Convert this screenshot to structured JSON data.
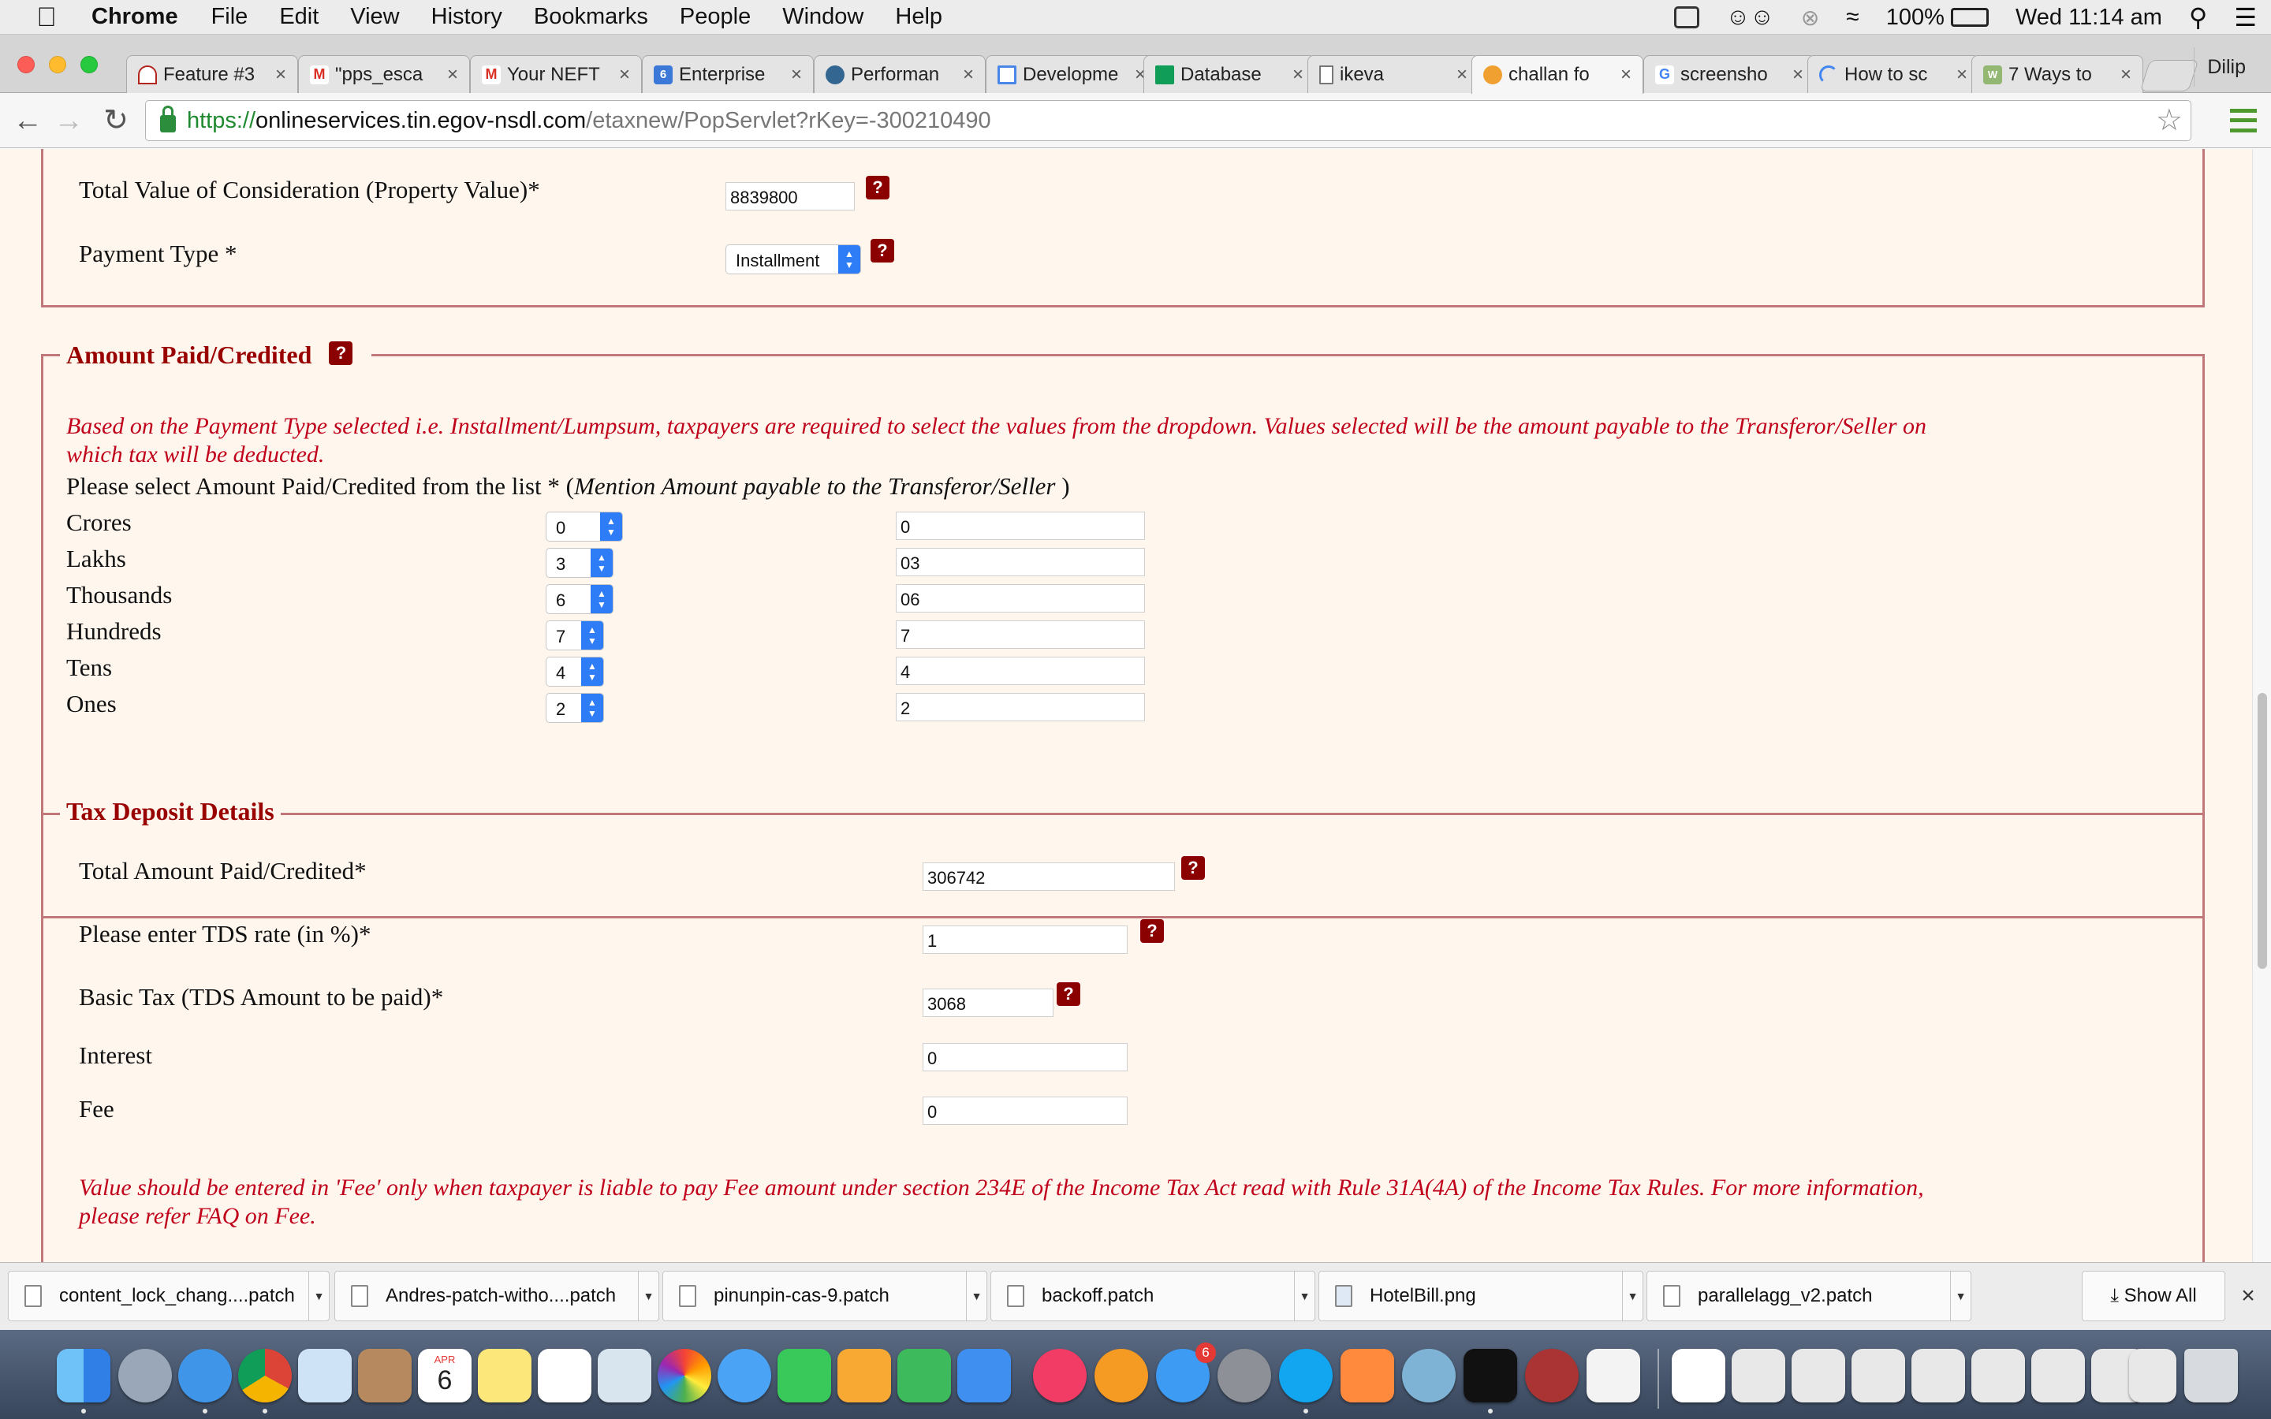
{
  "menubar": {
    "app": "Chrome",
    "menus": [
      "File",
      "Edit",
      "View",
      "History",
      "Bookmarks",
      "People",
      "Window",
      "Help"
    ],
    "battery": "100%",
    "clock": "Wed 11:14 am"
  },
  "tabs": [
    {
      "title": "Feature #3",
      "icon": "redmine-icon"
    },
    {
      "title": "\"pps_esca",
      "icon": "gmail-icon"
    },
    {
      "title": "Your NEFT",
      "icon": "gmail-icon"
    },
    {
      "title": "Enterprise",
      "icon": "calendar-icon"
    },
    {
      "title": "Performan",
      "icon": "postgres-icon"
    },
    {
      "title": "Developme",
      "icon": "doc-icon"
    },
    {
      "title": "Database",
      "icon": "sheets-icon"
    },
    {
      "title": "ikeva",
      "icon": "page-icon"
    },
    {
      "title": "challan fo",
      "icon": "site-icon"
    },
    {
      "title": "screensho",
      "icon": "google-icon"
    },
    {
      "title": "How to sc",
      "icon": "loading-icon"
    },
    {
      "title": "7 Ways to",
      "icon": "wikihow-icon"
    }
  ],
  "profile_name": "Dilip",
  "address_bar": {
    "scheme": "https://",
    "host": "onlineservices.tin.egov-nsdl.com",
    "path": "/etaxnew/PopServlet?rKey=-300210490"
  },
  "property": {
    "consideration_label": "Total Value of Consideration (Property Value)*",
    "consideration_value": "8839800",
    "payment_type_label": "Payment Type *",
    "payment_type_value": "Installment"
  },
  "amount_paid": {
    "legend": "Amount Paid/Credited",
    "note": "Based on the Payment Type selected i.e. Installment/Lumpsum, taxpayers are required to select the values from the dropdown. Values selected will be the amount payable to the Transferor/Seller on which tax will be deducted.",
    "select_prompt": "Please select Amount Paid/Credited from the list * (",
    "select_prompt_italic": "Mention Amount payable to the Transferor/Seller",
    "select_prompt_close": " )",
    "rows": [
      {
        "label": "Crores",
        "selected": "0",
        "value": "0"
      },
      {
        "label": "Lakhs",
        "selected": "3",
        "value": "03"
      },
      {
        "label": "Thousands",
        "selected": "6",
        "value": "06"
      },
      {
        "label": "Hundreds",
        "selected": "7",
        "value": "7"
      },
      {
        "label": "Tens",
        "selected": "4",
        "value": "4"
      },
      {
        "label": "Ones",
        "selected": "2",
        "value": "2"
      }
    ]
  },
  "tax_deposit": {
    "legend": "Tax Deposit Details",
    "total_label": "Total Amount Paid/Credited*",
    "total_value": "306742",
    "rate_label": "Please enter TDS rate (in %)*",
    "rate_value": "1",
    "basic_label": "Basic Tax (TDS Amount to be paid)*",
    "basic_value": "3068",
    "interest_label": "Interest",
    "interest_value": "0",
    "fee_label": "Fee",
    "fee_value": "0",
    "fee_note": "Value should be entered in 'Fee' only when taxpayer is liable to pay Fee amount under section 234E of the Income Tax Act read with Rule 31A(4A) of the Income Tax Rules. For more information, please refer FAQ on Fee."
  },
  "downloads": [
    "content_lock_chang....patch",
    "Andres-patch-witho....patch",
    "pinunpin-cas-9.patch",
    "backoff.patch",
    "HotelBill.png",
    "parallelagg_v2.patch"
  ],
  "show_all_label": "Show All",
  "dock": {
    "calendar_month": "APR",
    "calendar_day": "6",
    "appstore_badge": "6"
  },
  "colors": {
    "page_background": "#fff6ee",
    "legend_text": "#990000",
    "note_text": "#c0001a",
    "fieldset_border": "#c0787a",
    "help_icon": "#8b0000",
    "select_arrows": "#2e7cf6"
  }
}
